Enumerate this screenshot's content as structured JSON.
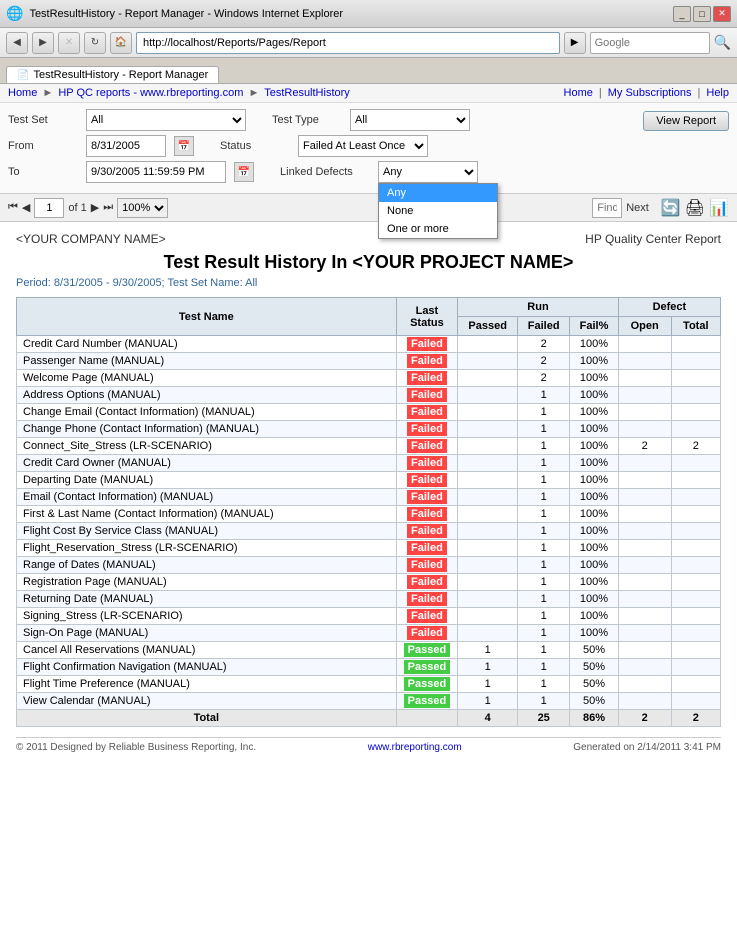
{
  "browser": {
    "title": "TestResultHistory - Report Manager - Windows Internet Explorer",
    "tab_label": "TestResultHistory - Report Manager",
    "address": "http://localhost/Reports/Pages/Report",
    "search_placeholder": "Google"
  },
  "breadcrumb": {
    "items": [
      "Home",
      "HP QC reports - www.rbreporting.com",
      "TestResultHistory"
    ],
    "right_items": [
      "Home",
      "My Subscriptions",
      "Help"
    ]
  },
  "filters": {
    "test_set_label": "Test Set",
    "test_set_value": "All",
    "test_type_label": "Test Type",
    "test_type_value": "All",
    "from_label": "From",
    "from_value": "8/31/2005",
    "status_label": "Status",
    "status_value": "Failed At Least Once",
    "to_label": "To",
    "to_value": "9/30/2005 11:59:59 PM",
    "linked_defects_label": "Linked Defects",
    "linked_defects_value": "Any",
    "view_report_label": "View Report",
    "dropdown_options": [
      "Any",
      "None",
      "One or more"
    ]
  },
  "pagination": {
    "current_page": "1",
    "total_pages": "of 1",
    "zoom": "100%",
    "find_label": "Find | Next"
  },
  "report": {
    "company_name": "<YOUR COMPANY NAME>",
    "brand": "HP Quality Center Report",
    "title": "Test Result History In <YOUR PROJECT NAME>",
    "period": "Period: 8/31/2005 - 9/30/2005; Test Set Name: All",
    "columns": {
      "test_name": "Test Name",
      "last_status": "Last Status",
      "run_passed": "Passed",
      "run_failed": "Failed",
      "run_fail_pct": "Fail%",
      "defect_open": "Open",
      "defect_total": "Total",
      "run_group": "Run",
      "defect_group": "Defect"
    },
    "rows": [
      {
        "name": "Credit Card Number (MANUAL)",
        "status": "Failed",
        "passed": "",
        "failed": "2",
        "fail_pct": "100%",
        "open": "",
        "total": ""
      },
      {
        "name": "Passenger Name (MANUAL)",
        "status": "Failed",
        "passed": "",
        "failed": "2",
        "fail_pct": "100%",
        "open": "",
        "total": ""
      },
      {
        "name": "Welcome Page (MANUAL)",
        "status": "Failed",
        "passed": "",
        "failed": "2",
        "fail_pct": "100%",
        "open": "",
        "total": ""
      },
      {
        "name": "Address Options (MANUAL)",
        "status": "Failed",
        "passed": "",
        "failed": "1",
        "fail_pct": "100%",
        "open": "",
        "total": ""
      },
      {
        "name": "Change Email (Contact Information) (MANUAL)",
        "status": "Failed",
        "passed": "",
        "failed": "1",
        "fail_pct": "100%",
        "open": "",
        "total": ""
      },
      {
        "name": "Change Phone (Contact Information) (MANUAL)",
        "status": "Failed",
        "passed": "",
        "failed": "1",
        "fail_pct": "100%",
        "open": "",
        "total": ""
      },
      {
        "name": "Connect_Site_Stress (LR-SCENARIO)",
        "status": "Failed",
        "passed": "",
        "failed": "1",
        "fail_pct": "100%",
        "open": "2",
        "total": "2"
      },
      {
        "name": "Credit Card Owner (MANUAL)",
        "status": "Failed",
        "passed": "",
        "failed": "1",
        "fail_pct": "100%",
        "open": "",
        "total": ""
      },
      {
        "name": "Departing Date (MANUAL)",
        "status": "Failed",
        "passed": "",
        "failed": "1",
        "fail_pct": "100%",
        "open": "",
        "total": ""
      },
      {
        "name": "Email (Contact Information) (MANUAL)",
        "status": "Failed",
        "passed": "",
        "failed": "1",
        "fail_pct": "100%",
        "open": "",
        "total": ""
      },
      {
        "name": "First & Last Name (Contact Information) (MANUAL)",
        "status": "Failed",
        "passed": "",
        "failed": "1",
        "fail_pct": "100%",
        "open": "",
        "total": ""
      },
      {
        "name": "Flight Cost By Service Class (MANUAL)",
        "status": "Failed",
        "passed": "",
        "failed": "1",
        "fail_pct": "100%",
        "open": "",
        "total": ""
      },
      {
        "name": "Flight_Reservation_Stress (LR-SCENARIO)",
        "status": "Failed",
        "passed": "",
        "failed": "1",
        "fail_pct": "100%",
        "open": "",
        "total": ""
      },
      {
        "name": "Range of Dates (MANUAL)",
        "status": "Failed",
        "passed": "",
        "failed": "1",
        "fail_pct": "100%",
        "open": "",
        "total": ""
      },
      {
        "name": "Registration Page (MANUAL)",
        "status": "Failed",
        "passed": "",
        "failed": "1",
        "fail_pct": "100%",
        "open": "",
        "total": ""
      },
      {
        "name": "Returning Date (MANUAL)",
        "status": "Failed",
        "passed": "",
        "failed": "1",
        "fail_pct": "100%",
        "open": "",
        "total": ""
      },
      {
        "name": "Signing_Stress (LR-SCENARIO)",
        "status": "Failed",
        "passed": "",
        "failed": "1",
        "fail_pct": "100%",
        "open": "",
        "total": ""
      },
      {
        "name": "Sign-On Page (MANUAL)",
        "status": "Failed",
        "passed": "",
        "failed": "1",
        "fail_pct": "100%",
        "open": "",
        "total": ""
      },
      {
        "name": "Cancel All Reservations (MANUAL)",
        "status": "Passed",
        "passed": "1",
        "failed": "1",
        "fail_pct": "50%",
        "open": "",
        "total": ""
      },
      {
        "name": "Flight Confirmation Navigation (MANUAL)",
        "status": "Passed",
        "passed": "1",
        "failed": "1",
        "fail_pct": "50%",
        "open": "",
        "total": ""
      },
      {
        "name": "Flight Time Preference (MANUAL)",
        "status": "Passed",
        "passed": "1",
        "failed": "1",
        "fail_pct": "50%",
        "open": "",
        "total": ""
      },
      {
        "name": "View Calendar (MANUAL)",
        "status": "Passed",
        "passed": "1",
        "failed": "1",
        "fail_pct": "50%",
        "open": "",
        "total": ""
      }
    ],
    "totals": {
      "label": "Total",
      "passed": "4",
      "failed": "25",
      "fail_pct": "86%",
      "open": "2",
      "total": "2"
    }
  },
  "footer": {
    "copyright": "© 2011 Designed by Reliable Business Reporting, Inc.",
    "website_text": "www.rbreporting.com",
    "website_url": "http://www.rbreporting.com",
    "generated": "Generated on 2/14/2011 3:41 PM"
  }
}
